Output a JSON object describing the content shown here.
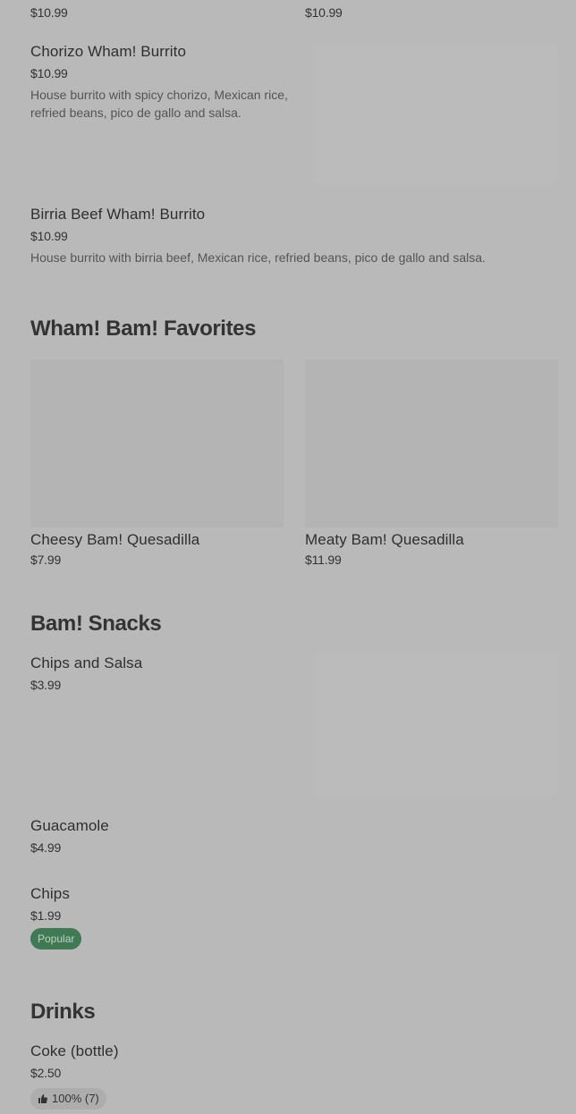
{
  "top_cut": {
    "left_price": "$10.99",
    "right_price": "$10.99"
  },
  "burritos": [
    {
      "name": "Chorizo Wham! Burrito",
      "price": "$10.99",
      "description": "House burrito with spicy chorizo, Mexican rice, refried beans, pico de gallo and salsa."
    },
    {
      "name": "Birria Beef Wham! Burrito",
      "price": "$10.99",
      "description": "House burrito with birria beef, Mexican rice, refried beans, pico de gallo and salsa."
    }
  ],
  "favorites": {
    "title": "Wham! Bam! Favorites",
    "items": [
      {
        "name": "Cheesy Bam! Quesadilla",
        "price": "$7.99"
      },
      {
        "name": "Meaty Bam! Quesadilla",
        "price": "$11.99"
      }
    ]
  },
  "snacks": {
    "title": "Bam! Snacks",
    "items": [
      {
        "name": "Chips and Salsa",
        "price": "$3.99"
      },
      {
        "name": "Guacamole",
        "price": "$4.99"
      },
      {
        "name": "Chips",
        "price": "$1.99",
        "badge": "Popular"
      }
    ]
  },
  "drinks": {
    "title": "Drinks",
    "items": [
      {
        "name": "Coke (bottle)",
        "price": "$2.50",
        "rating": "100% (7)",
        "rating_icon": "thumbs-up-icon"
      }
    ]
  },
  "colors": {
    "overlay_bg": "#b9b9b9",
    "popular_badge": "#3f7a55"
  }
}
